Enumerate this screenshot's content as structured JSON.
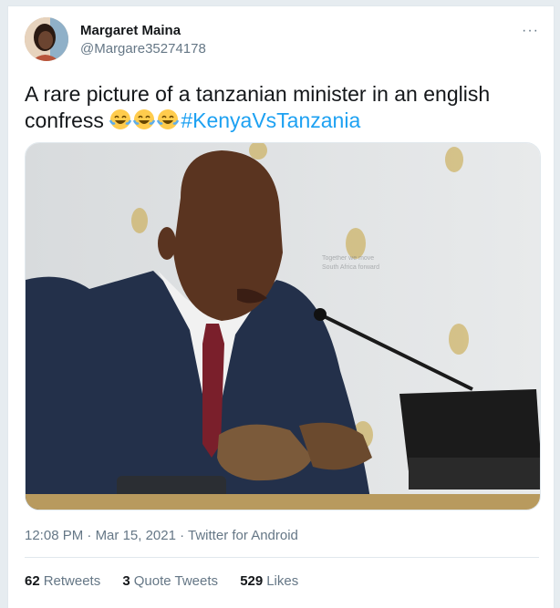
{
  "user": {
    "display_name": "Margaret Maina",
    "handle": "@Margare35274178",
    "avatar_icon": "profile-avatar"
  },
  "menu": {
    "more_label": "···"
  },
  "tweet": {
    "text": "A rare picture of a tanzanian minister in an english confress ",
    "emojis": [
      "face-with-tears-of-joy",
      "face-with-tears-of-joy",
      "face-with-tears-of-joy"
    ],
    "hashtag": "#KenyaVsTanzania"
  },
  "media": {
    "seal_labels": [
      "Together we move",
      "South Africa forward"
    ]
  },
  "meta": {
    "time": "12:08 PM",
    "separator": " · ",
    "date": "Mar 15, 2021",
    "source": "Twitter for Android"
  },
  "stats": {
    "retweets_count": "62",
    "retweets_label": "Retweets",
    "quotes_count": "3",
    "quotes_label": "Quote Tweets",
    "likes_count": "529",
    "likes_label": "Likes"
  },
  "colors": {
    "accent": "#1da1f2",
    "text": "#14171a",
    "secondary": "#657786",
    "border": "#e1e8ed"
  }
}
